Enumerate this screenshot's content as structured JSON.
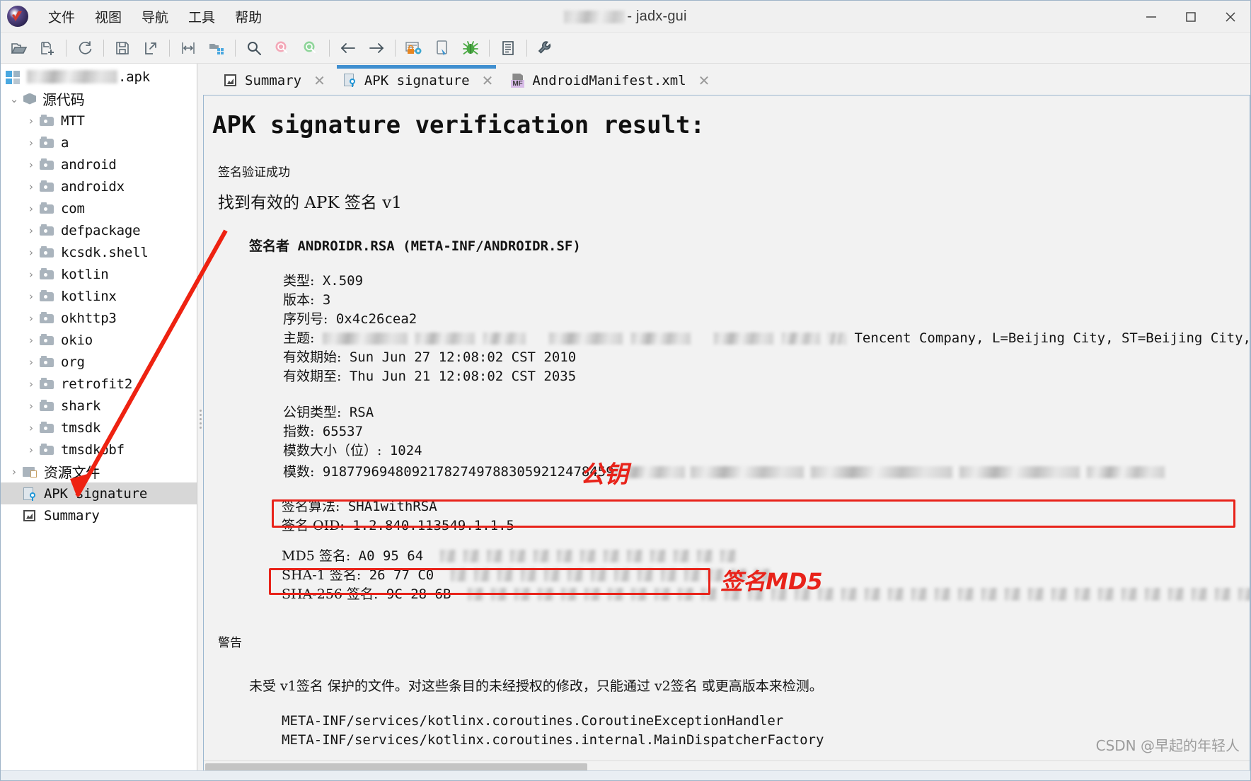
{
  "window": {
    "title_suffix": " - jadx-gui",
    "title_redacted": true,
    "minimize": "─",
    "maximize": "☐",
    "close": "✕"
  },
  "menubar": {
    "items": [
      {
        "label": "文件",
        "name": "menu-file"
      },
      {
        "label": "视图",
        "name": "menu-view"
      },
      {
        "label": "导航",
        "name": "menu-navigate"
      },
      {
        "label": "工具",
        "name": "menu-tools"
      },
      {
        "label": "帮助",
        "name": "menu-help"
      }
    ]
  },
  "toolbar": {
    "buttons": [
      {
        "name": "open-file-icon"
      },
      {
        "name": "add-files-icon"
      },
      {
        "name": "reload-icon"
      },
      {
        "name": "save-all-icon"
      },
      {
        "name": "export-gradle-icon"
      },
      {
        "name": "sync-icon"
      },
      {
        "name": "flat-packages-icon"
      },
      {
        "name": "search-icon"
      },
      {
        "name": "search-class-icon"
      },
      {
        "name": "search-comment-icon"
      },
      {
        "name": "back-arrow-icon"
      },
      {
        "name": "forward-arrow-icon"
      },
      {
        "name": "deobfuscation-icon"
      },
      {
        "name": "quark-icon"
      },
      {
        "name": "debug-icon"
      },
      {
        "name": "logs-icon"
      },
      {
        "name": "preferences-icon"
      }
    ]
  },
  "sidebar": {
    "root": {
      "label": ".apk",
      "redacted": true,
      "icon": "apk-icon"
    },
    "items": [
      {
        "label": "源代码",
        "icon": "package-icon",
        "indent": 1,
        "twisty": "⌄",
        "cjk": true,
        "expanded": true,
        "name": "sidebar-item-source-code"
      },
      {
        "label": "MTT",
        "icon": "folder-icon",
        "indent": 2,
        "twisty": "›",
        "name": "sidebar-item-mtt"
      },
      {
        "label": "a",
        "icon": "folder-icon",
        "indent": 2,
        "twisty": "›",
        "name": "sidebar-item-a"
      },
      {
        "label": "android",
        "icon": "folder-icon",
        "indent": 2,
        "twisty": "›",
        "name": "sidebar-item-android"
      },
      {
        "label": "androidx",
        "icon": "folder-icon",
        "indent": 2,
        "twisty": "›",
        "name": "sidebar-item-androidx"
      },
      {
        "label": "com",
        "icon": "folder-icon",
        "indent": 2,
        "twisty": "›",
        "name": "sidebar-item-com"
      },
      {
        "label": "defpackage",
        "icon": "folder-icon",
        "indent": 2,
        "twisty": "›",
        "name": "sidebar-item-defpackage"
      },
      {
        "label": "kcsdk.shell",
        "icon": "folder-icon",
        "indent": 2,
        "twisty": "›",
        "name": "sidebar-item-kcsdk-shell"
      },
      {
        "label": "kotlin",
        "icon": "folder-icon",
        "indent": 2,
        "twisty": "›",
        "name": "sidebar-item-kotlin"
      },
      {
        "label": "kotlinx",
        "icon": "folder-icon",
        "indent": 2,
        "twisty": "›",
        "name": "sidebar-item-kotlinx"
      },
      {
        "label": "okhttp3",
        "icon": "folder-icon",
        "indent": 2,
        "twisty": "›",
        "name": "sidebar-item-okhttp3"
      },
      {
        "label": "okio",
        "icon": "folder-icon",
        "indent": 2,
        "twisty": "›",
        "name": "sidebar-item-okio"
      },
      {
        "label": "org",
        "icon": "folder-icon",
        "indent": 2,
        "twisty": "›",
        "name": "sidebar-item-org"
      },
      {
        "label": "retrofit2",
        "icon": "folder-icon",
        "indent": 2,
        "twisty": "›",
        "name": "sidebar-item-retrofit2"
      },
      {
        "label": "shark",
        "icon": "folder-icon",
        "indent": 2,
        "twisty": "›",
        "name": "sidebar-item-shark"
      },
      {
        "label": "tmsdk",
        "icon": "folder-icon",
        "indent": 2,
        "twisty": "›",
        "name": "sidebar-item-tmsdk"
      },
      {
        "label": "tmsdkobf",
        "icon": "folder-icon",
        "indent": 2,
        "twisty": "›",
        "name": "sidebar-item-tmsdkobf"
      },
      {
        "label": "资源文件",
        "icon": "resources-icon",
        "indent": 1,
        "twisty": "›",
        "cjk": true,
        "name": "sidebar-item-resources"
      },
      {
        "label": "APK signature",
        "icon": "signature-icon",
        "indent": 1,
        "twisty": "",
        "selected": true,
        "name": "sidebar-item-apk-signature"
      },
      {
        "label": "Summary",
        "icon": "summary-icon",
        "indent": 1,
        "twisty": "",
        "name": "sidebar-item-summary"
      }
    ]
  },
  "tabs": [
    {
      "label": "Summary",
      "icon": "summary-icon",
      "active": false,
      "closable": true,
      "name": "tab-summary"
    },
    {
      "label": "APK signature",
      "icon": "signature-icon",
      "active": true,
      "closable": true,
      "name": "tab-apk-signature"
    },
    {
      "label": "AndroidManifest.xml",
      "icon": "manifest-icon",
      "active": false,
      "closable": true,
      "name": "tab-androidmanifest"
    }
  ],
  "document": {
    "heading": "APK signature verification result:",
    "status_ok": "签名验证成功",
    "found_signature": "找到有效的 APK 签名 v1",
    "signer_line": "签名者 ANDROIDR.RSA (META-INF/ANDROIDR.SF)",
    "fields": {
      "type_label": "类型:",
      "type_value": "X.509",
      "version_label": "版本:",
      "version_value": "3",
      "serial_label": "序列号:",
      "serial_value": "0x4c26cea2",
      "subject_label": "主题:",
      "subject_tail": "Tencent Company, L=Beijing City, ST=Beijing City,",
      "valid_from_label": "有效期始:",
      "valid_from_value": "Sun Jun 27 12:08:02 CST 2010",
      "valid_to_label": "有效期至:",
      "valid_to_value": "Thu Jun 21 12:08:02 CST 2035",
      "pubkey_type_label": "公钥类型:",
      "pubkey_type_value": "RSA",
      "exponent_label": "指数:",
      "exponent_value": "65537",
      "modulus_size_label": "模数大小（位）:",
      "modulus_size_value": "1024",
      "modulus_label": "模数:",
      "modulus_value": "918779694809217827497883059212478459",
      "sig_algo_label": "签名算法:",
      "sig_algo_value": "SHA1withRSA",
      "sig_oid_label": "签名 OID:",
      "sig_oid_value": "1.2.840.113549.1.1.5",
      "md5_label": "MD5 签名:",
      "md5_value": "A0 95 64",
      "sha1_label": "SHA-1 签名:",
      "sha1_value": "26 77 C0",
      "sha256_label": "SHA-256 签名:",
      "sha256_value": "9C 28 6B"
    },
    "warning_heading": "警告",
    "warning_text": "未受 v1签名 保护的文件。对这些条目的未经授权的修改，只能通过 v2签名 或更高版本来检测。",
    "warning_files": [
      "META-INF/services/kotlinx.coroutines.CoroutineExceptionHandler",
      "META-INF/services/kotlinx.coroutines.internal.MainDispatcherFactory"
    ]
  },
  "annotations": [
    {
      "label": "公钥",
      "name": "annotation-public-key",
      "color": "#e8231a"
    },
    {
      "label": "签名MD5",
      "name": "annotation-signature-md5",
      "color": "#e8231a"
    }
  ],
  "watermark": "CSDN @早起的年轻人",
  "colors": {
    "accent": "#3f8fd0",
    "annotation_red": "#e8231a",
    "selection": "#d7d7d7"
  }
}
